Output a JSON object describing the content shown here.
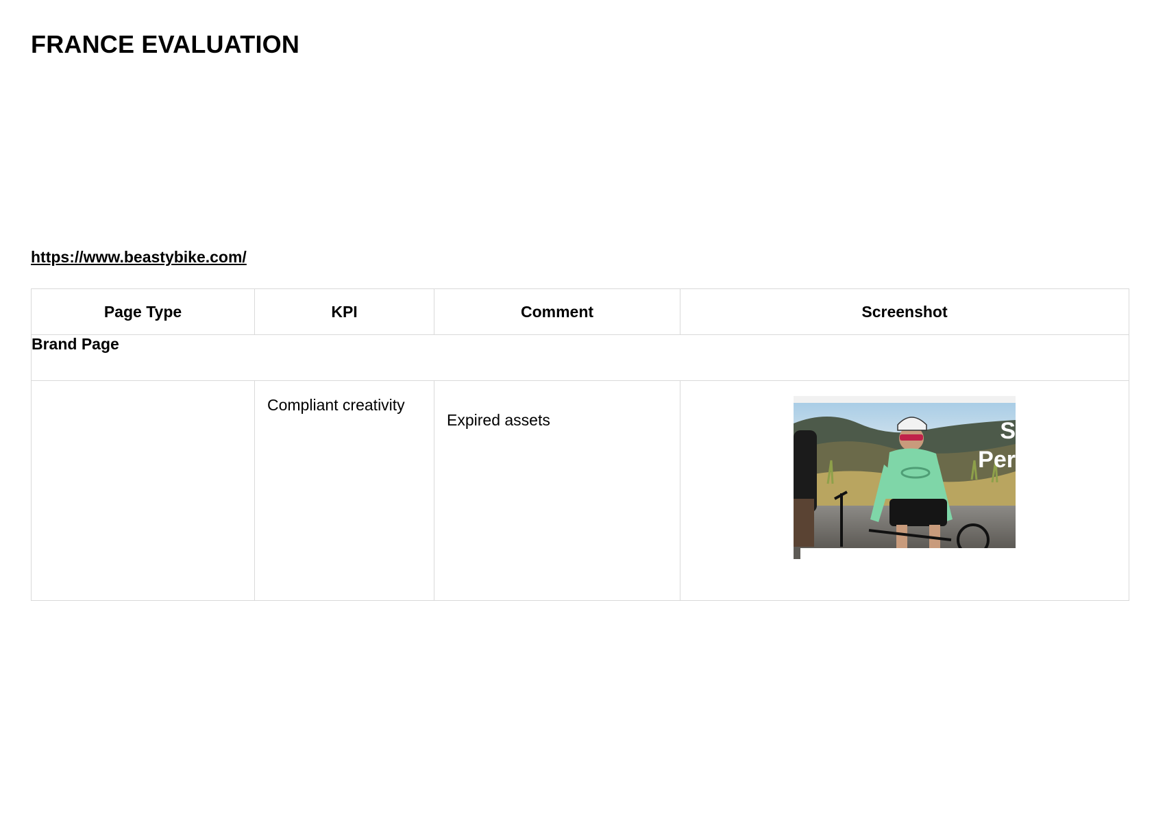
{
  "page": {
    "title": "FRANCE EVALUATION",
    "link": "https://www.beastybike.com/"
  },
  "table": {
    "headers": [
      "Page Type",
      "KPI",
      "Comment",
      "Screenshot"
    ],
    "sections": [
      {
        "label": "Brand Page",
        "rows": [
          {
            "page_type": "",
            "kpi": "Compliant creativity",
            "comment": "Expired assets",
            "screenshot": {
              "overlay_text_1": "S",
              "overlay_text_2": "Per"
            }
          }
        ]
      }
    ]
  },
  "colors": {
    "grid": "#d9d9d9",
    "jersey": "#7fd6a8",
    "sky": "#b9d5e6"
  }
}
